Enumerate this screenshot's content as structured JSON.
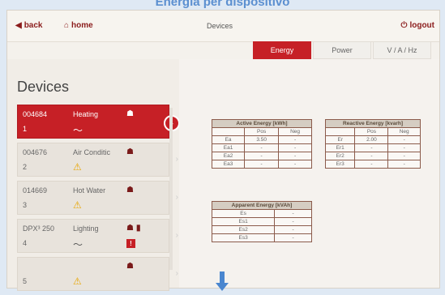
{
  "caption": "Energia per dispositivo",
  "nav": {
    "back": "back",
    "home": "home",
    "logout": "logout",
    "title": "Devices"
  },
  "tabs": [
    "Energy",
    "Power",
    "V / A / Hz"
  ],
  "page_title": "Devices",
  "devices": [
    {
      "id": "004684",
      "name": "Heating",
      "num": "1",
      "status": "wifi",
      "selected": true
    },
    {
      "id": "004676",
      "name": "Air Conditic",
      "num": "2",
      "status": "warning",
      "selected": false
    },
    {
      "id": "014669",
      "name": "Hot Water",
      "num": "3",
      "status": "warning",
      "selected": false
    },
    {
      "id": "DPX³ 250",
      "name": "Lighting",
      "num": "4",
      "status": "wifi",
      "selected": false,
      "alert": "!"
    },
    {
      "id": "",
      "name": "",
      "num": "5",
      "status": "warning",
      "selected": false
    }
  ],
  "active_energy": {
    "title": "Active Energy [kWh]",
    "cols": [
      "",
      "Pos",
      "Neg"
    ],
    "rows": [
      [
        "Ea",
        "3.50",
        "-"
      ],
      [
        "Ea1",
        "-",
        "-"
      ],
      [
        "Ea2",
        "-",
        "-"
      ],
      [
        "Ea3",
        "-",
        "-"
      ]
    ]
  },
  "reactive_energy": {
    "title": "Reactive Energy [kvarh]",
    "cols": [
      "",
      "Pos",
      "Neg"
    ],
    "rows": [
      [
        "Er",
        "2.00",
        "-"
      ],
      [
        "Er1",
        "-",
        "-"
      ],
      [
        "Er2",
        "-",
        "-"
      ],
      [
        "Er3",
        "-",
        "-"
      ]
    ]
  },
  "apparent_energy": {
    "title": "Apparent Energy [kVAh]",
    "rows": [
      [
        "Es",
        "-"
      ],
      [
        "Es1",
        "-"
      ],
      [
        "Es2",
        "-"
      ],
      [
        "Es3",
        "-"
      ]
    ]
  }
}
